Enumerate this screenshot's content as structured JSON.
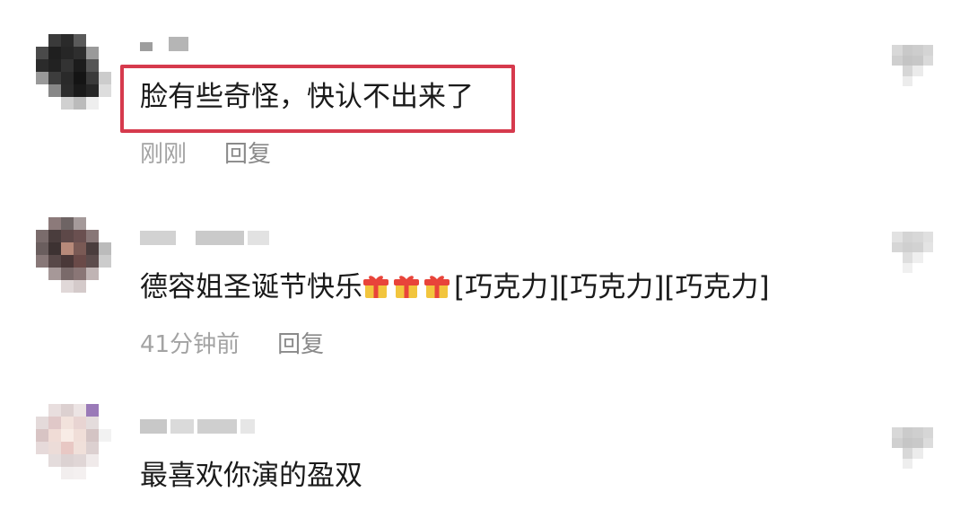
{
  "comments": [
    {
      "text": "脸有些奇怪，快认不出来了",
      "time": "刚刚",
      "reply": "回复"
    },
    {
      "text_main": "德容姐圣诞节快乐",
      "gift_icons": [
        "gift-emoji",
        "gift-emoji",
        "gift-emoji"
      ],
      "text_tail": "[巧克力][巧克力][巧克力]",
      "time": "41分钟前",
      "reply": "回复"
    },
    {
      "text": "最喜欢你演的盈双"
    }
  ],
  "colors": {
    "highlight_border": "#d63a4d",
    "text": "#1a1a1a",
    "meta": "#a3a3a3"
  }
}
